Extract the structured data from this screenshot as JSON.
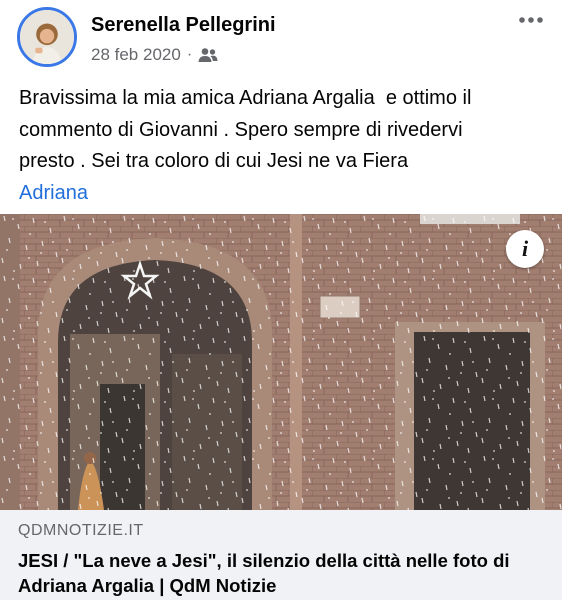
{
  "post": {
    "author": "Serenella Pellegrini",
    "date": "28 feb 2020",
    "separator": "·",
    "audience_icon": "friends-icon",
    "more_icon": "more-dots-icon",
    "text_lines": [
      "Bravissima la mia amica Adriana Argalia  e ottimo il",
      "commento di Giovanni . Spero sempre di rivedervi",
      "presto . Sei tra coloro di cui Jesi ne va Fiera"
    ],
    "mention": "Adriana"
  },
  "link_preview": {
    "info_label": "i",
    "domain": "QDMNOTIZIE.IT",
    "title": "JESI / \"La neve a Jesi\", il silenzio della città nelle foto di Adriana Argalia | QdM Notizie"
  },
  "colors": {
    "mention": "#216fdb",
    "avatar_ring": "#3b78e7",
    "meta_text": "#65676b",
    "footer_bg": "#f0f2f5"
  }
}
